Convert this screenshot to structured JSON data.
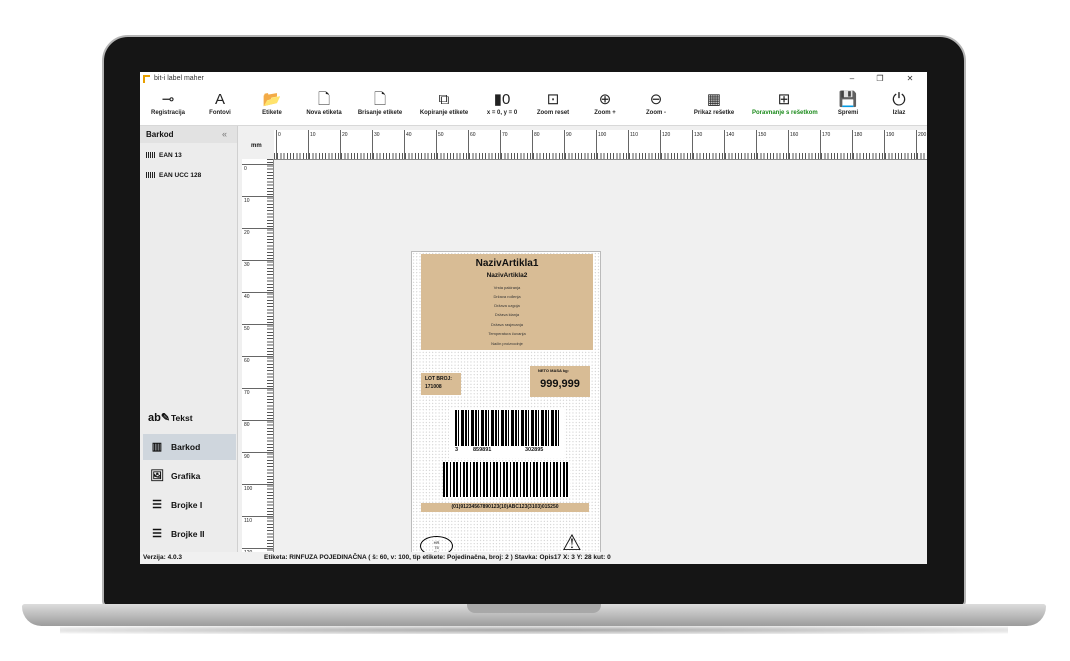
{
  "window": {
    "title": "bit-i label maher",
    "controls": [
      "–",
      "❐",
      "✕"
    ]
  },
  "toolbar": [
    {
      "label": "Registracija",
      "icon": "⊸"
    },
    {
      "label": "Fontovi",
      "icon": "A"
    },
    {
      "label": "Etikete",
      "icon": "📂"
    },
    {
      "label": "Nova etiketa",
      "icon": "🗋"
    },
    {
      "label": "Brisanje etikete",
      "icon": "🗋"
    },
    {
      "label": "Kopiranje etikete",
      "icon": "⧉"
    },
    {
      "label": "x = 0,  y = 0",
      "icon": "▮0"
    },
    {
      "label": "Zoom reset",
      "icon": "⊡"
    },
    {
      "label": "Zoom +",
      "icon": "⊕"
    },
    {
      "label": "Zoom -",
      "icon": "⊖"
    },
    {
      "label": "Prikaz rešetke",
      "icon": "▦"
    },
    {
      "label": "Poravnanje s rešetkom",
      "icon": "⊞"
    },
    {
      "label": "Spremi",
      "icon": "💾"
    },
    {
      "label": "Izlaz",
      "icon": "⏻"
    }
  ],
  "colors": {
    "snap_label": "#1a8a1a",
    "label_fill": "#d8bc95"
  },
  "left_panel": {
    "title": "Barkod",
    "collapse": "«",
    "barcode_types": [
      "EAN 13",
      "EAN UCC 128"
    ],
    "tools": [
      {
        "label": "Tekst",
        "icon": "ab✎"
      },
      {
        "label": "Barkod",
        "icon": "▥"
      },
      {
        "label": "Grafika",
        "icon": "🖼"
      },
      {
        "label": "Brojke I",
        "icon": "☰"
      },
      {
        "label": "Brojke II",
        "icon": "☰"
      }
    ]
  },
  "ruler": {
    "unit": "mm",
    "h_ticks": [
      "0",
      "10",
      "20",
      "30",
      "40",
      "50",
      "60",
      "70",
      "80",
      "90",
      "100",
      "110",
      "120",
      "130",
      "140",
      "150",
      "160",
      "170",
      "180",
      "190",
      "200"
    ],
    "v_ticks": [
      "0",
      "10",
      "20",
      "30",
      "40",
      "50",
      "60",
      "70",
      "80",
      "90",
      "100",
      "110",
      "120"
    ]
  },
  "label": {
    "title": "NazivArtikla1",
    "subtitle": "NazivArtikla2",
    "lines": [
      "Vrsta pakiranja",
      "Država rođenja",
      "Država uzgoja",
      "Država klanja",
      "Država rasjecanja",
      "Temperatura čuvanja",
      "Način proizvodnje"
    ],
    "lot_label": "LOT BROJ:",
    "lot_value": "171008",
    "neto_label": "NETO MASA kg:",
    "neto_value": "999,999",
    "ean_digits": [
      "3",
      "859891",
      "302895"
    ],
    "gs1_text": "(01)91234567890123(10)ABC123(3103)015250",
    "oval_text": [
      "HR",
      "75",
      "EU"
    ],
    "warning": "⚠"
  },
  "right_tools": [
    "✕",
    "⎘",
    "↻",
    "✥"
  ],
  "status": {
    "version": "Verzija: 4.0.3",
    "info": "Etiketa: RINFUZA POJEDINAČNA ( š: 60, v: 100, tip etikete: Pojedinačna, broj: 2 )  Stavka: Opis17  X: 3  Y: 28  kut: 0"
  }
}
